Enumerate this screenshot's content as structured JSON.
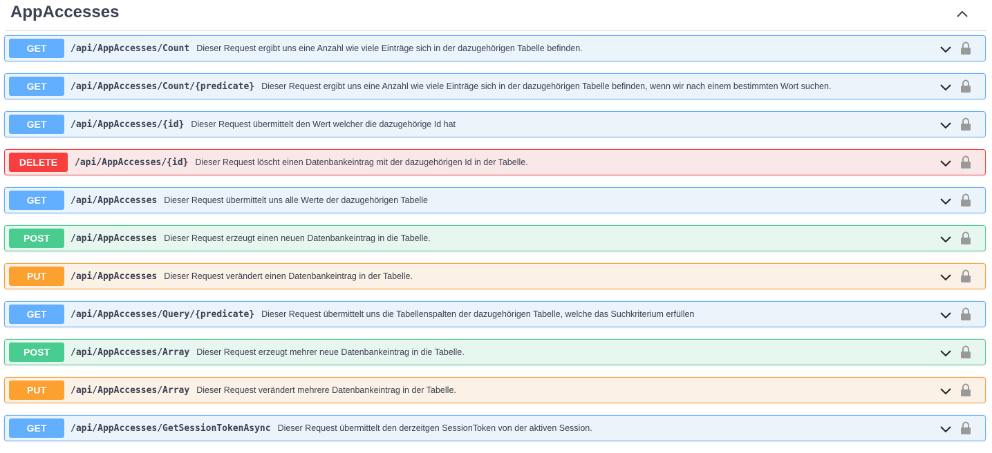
{
  "section": {
    "title": "AppAccesses",
    "toggle_icon": "chevron-up-icon"
  },
  "colors": {
    "get": "#61affe",
    "post": "#49cc90",
    "put": "#fca130",
    "delete": "#f93e3e"
  },
  "operations": [
    {
      "method": "GET",
      "path": "/api/AppAccesses/Count",
      "summary": "Dieser Request ergibt uns eine Anzahl wie viele Einträge sich in der dazugehörigen Tabelle befinden."
    },
    {
      "method": "GET",
      "path": "/api/AppAccesses/Count/{predicate}",
      "summary": "Dieser Request ergibt uns eine Anzahl wie viele Einträge sich in der dazugehörigen Tabelle befinden, wenn wir nach einem bestimmten Wort suchen."
    },
    {
      "method": "GET",
      "path": "/api/AppAccesses/{id}",
      "summary": "Dieser Request übermittelt den Wert welcher die dazugehörige Id hat"
    },
    {
      "method": "DELETE",
      "path": "/api/AppAccesses/{id}",
      "summary": "Dieser Request löscht einen Datenbankeintrag mit der dazugehörigen Id in der Tabelle."
    },
    {
      "method": "GET",
      "path": "/api/AppAccesses",
      "summary": "Dieser Request übermittelt uns alle Werte der dazugehörigen Tabelle"
    },
    {
      "method": "POST",
      "path": "/api/AppAccesses",
      "summary": "Dieser Request erzeugt einen neuen Datenbankeintrag in die Tabelle."
    },
    {
      "method": "PUT",
      "path": "/api/AppAccesses",
      "summary": "Dieser Request verändert einen Datenbankeintrag in der Tabelle."
    },
    {
      "method": "GET",
      "path": "/api/AppAccesses/Query/{predicate}",
      "summary": "Dieser Request übermittelt uns die Tabellenspalten der dazugehörigen Tabelle, welche das Suchkriterium erfüllen"
    },
    {
      "method": "POST",
      "path": "/api/AppAccesses/Array",
      "summary": "Dieser Request erzeugt mehrer neue Datenbankeintrag in die Tabelle."
    },
    {
      "method": "PUT",
      "path": "/api/AppAccesses/Array",
      "summary": "Dieser Request verändert mehrere Datenbankeintrag in der Tabelle."
    },
    {
      "method": "GET",
      "path": "/api/AppAccesses/GetSessionTokenAsync",
      "summary": "Dieser Request übermittelt den derzeitgen SessionToken von der aktiven Session."
    }
  ]
}
